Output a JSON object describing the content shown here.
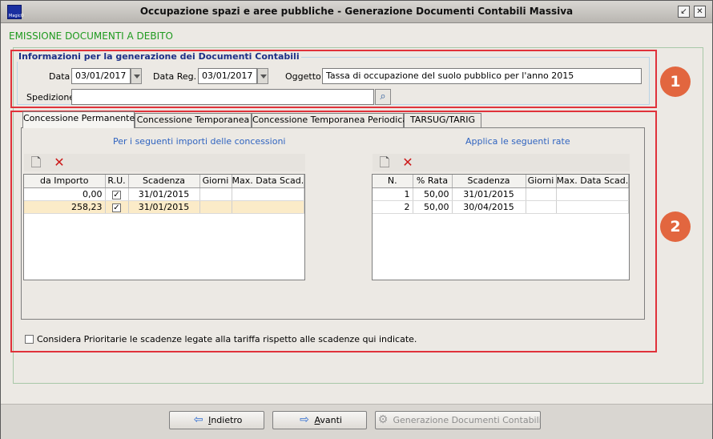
{
  "window": {
    "title": "Occupazione spazi e aree pubbliche - Generazione Documenti Contabili Massiva",
    "icon_label": "MagicO"
  },
  "header": {
    "title": "EMISSIONE DOCUMENTI A DEBITO"
  },
  "badges": {
    "one": "1",
    "two": "2"
  },
  "info_group": {
    "legend": "Informazioni per la generazione dei Documenti Contabili",
    "data_label": "Data",
    "data_value": "03/01/2017",
    "data_reg_label": "Data Reg.",
    "data_reg_value": "03/01/2017",
    "oggetto_label": "Oggetto",
    "oggetto_value": "Tassa di occupazione del suolo pubblico per l'anno 2015",
    "spedizione_label": "Spedizione",
    "spedizione_value": ""
  },
  "tabs": [
    {
      "label": "Concessione Permanente"
    },
    {
      "label": "Concessione Temporanea"
    },
    {
      "label": "Concessione Temporanea Periodica"
    },
    {
      "label": "TARSUG/TARIG"
    }
  ],
  "left_grid": {
    "caption": "Per i seguenti importi delle concessioni",
    "columns": [
      "da Importo",
      "R.U.",
      "Scadenza",
      "Giorni",
      "Max. Data Scad."
    ],
    "rows": [
      {
        "importo": "0,00",
        "ru": "✓",
        "scadenza": "31/01/2015",
        "giorni": "",
        "max": ""
      },
      {
        "importo": "258,23",
        "ru": "✓",
        "scadenza": "31/01/2015",
        "giorni": "",
        "max": ""
      }
    ]
  },
  "right_grid": {
    "caption": "Applica le seguenti rate",
    "columns": [
      "N.",
      "% Rata",
      "Scadenza",
      "Giorni",
      "Max. Data Scad."
    ],
    "rows": [
      {
        "n": "1",
        "rata": "50,00",
        "scadenza": "31/01/2015",
        "giorni": "",
        "max": ""
      },
      {
        "n": "2",
        "rata": "50,00",
        "scadenza": "30/04/2015",
        "giorni": "",
        "max": ""
      }
    ]
  },
  "priority_checkbox": {
    "label": "Considera Prioritarie le scadenze legate alla tariffa rispetto alle scadenze qui indicate.",
    "checked": false
  },
  "footer": {
    "back_label_u": "I",
    "back_label_rest": "ndietro",
    "next_label_u": "A",
    "next_label_rest": "vanti",
    "generate_label": "Generazione Documenti Contabili"
  },
  "colors": {
    "header_green": "#1f9a1f",
    "annotation_red": "#e0323a",
    "badge_orange": "#e2663f",
    "caption_blue": "#3064c0",
    "selected_row": "#fbebc8"
  }
}
